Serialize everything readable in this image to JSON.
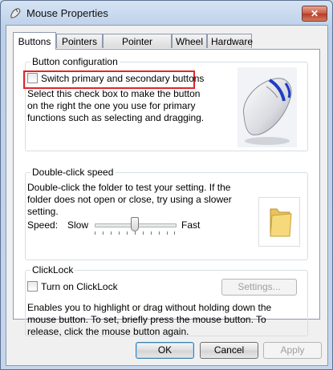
{
  "window": {
    "title": "Mouse Properties",
    "close_label": "✕"
  },
  "tabs": [
    {
      "label": "Buttons",
      "active": true
    },
    {
      "label": "Pointers",
      "active": false
    },
    {
      "label": "Pointer Options",
      "active": false
    },
    {
      "label": "Wheel",
      "active": false
    },
    {
      "label": "Hardware",
      "active": false
    }
  ],
  "button_config": {
    "title": "Button configuration",
    "switch_label": "Switch primary and secondary buttons",
    "switch_checked": false,
    "description": "Select this check box to make the button on the right the one you use for primary functions such as selecting and dragging."
  },
  "double_click": {
    "title": "Double-click speed",
    "description": "Double-click the folder to test your setting. If the folder does not open or close, try using a slower setting.",
    "speed_label": "Speed:",
    "slow_label": "Slow",
    "fast_label": "Fast",
    "speed_level": 0.5
  },
  "clicklock": {
    "title": "ClickLock",
    "checkbox_label": "Turn on ClickLock",
    "checked": false,
    "settings_label": "Settings...",
    "description": "Enables you to highlight or drag without holding down the mouse button. To set, briefly press the mouse button. To release, click the mouse button again."
  },
  "footer": {
    "ok_label": "OK",
    "cancel_label": "Cancel",
    "apply_label": "Apply"
  },
  "colors": {
    "highlight": "#e0262a",
    "accent_blue": "#1f3cc8"
  }
}
